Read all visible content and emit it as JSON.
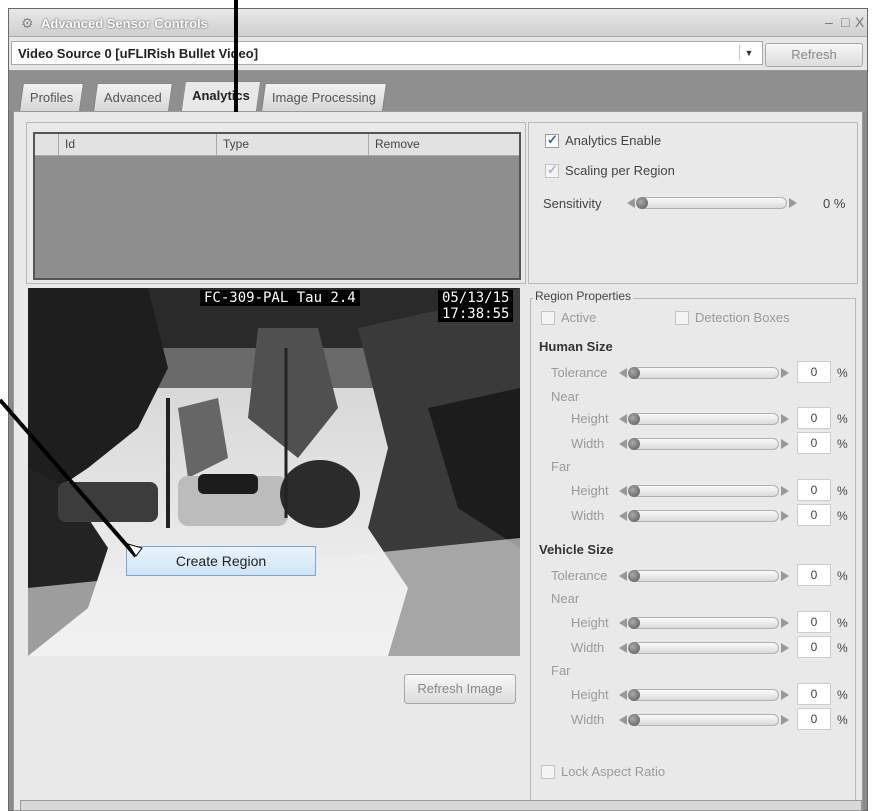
{
  "window": {
    "title": "Advanced Sensor Controls",
    "minimize": "–",
    "maximize": "□",
    "close": "X",
    "app_icon": "gear-icon"
  },
  "source": {
    "selected": "Video Source 0 [uFLIRish Bullet Video]",
    "refresh_label": "Refresh"
  },
  "tabs": [
    {
      "label": "Profiles",
      "active": false
    },
    {
      "label": "Advanced",
      "active": false
    },
    {
      "label": "Analytics",
      "active": true
    },
    {
      "label": "Image Processing",
      "active": false
    }
  ],
  "region_table": {
    "columns": [
      "Id",
      "Type",
      "Remove"
    ]
  },
  "analytics": {
    "enable_label": "Analytics Enable",
    "enable_checked": true,
    "scaling_label": "Scaling per Region",
    "scaling_checked": true,
    "sensitivity_label": "Sensitivity",
    "sensitivity_value": "0 %"
  },
  "video": {
    "osd_camera": "FC-309-PAL Tau 2.4",
    "osd_date": "05/13/15",
    "osd_time": "17:38:55",
    "refresh_image_label": "Refresh Image"
  },
  "context_menu": {
    "item": "Create Region"
  },
  "region_properties": {
    "title": "Region Properties",
    "active_label": "Active",
    "detection_boxes_label": "Detection Boxes",
    "human_title": "Human Size",
    "vehicle_title": "Vehicle Size",
    "tolerance_label": "Tolerance",
    "near_label": "Near",
    "far_label": "Far",
    "height_label": "Height",
    "width_label": "Width",
    "unit": "%",
    "values": {
      "human_tolerance": "0",
      "human_near_height": "0",
      "human_near_width": "0",
      "human_far_height": "0",
      "human_far_width": "0",
      "vehicle_tolerance": "0",
      "vehicle_near_height": "0",
      "vehicle_near_width": "0",
      "vehicle_far_height": "0",
      "vehicle_far_width": "0"
    },
    "lock_aspect_label": "Lock Aspect Ratio"
  }
}
